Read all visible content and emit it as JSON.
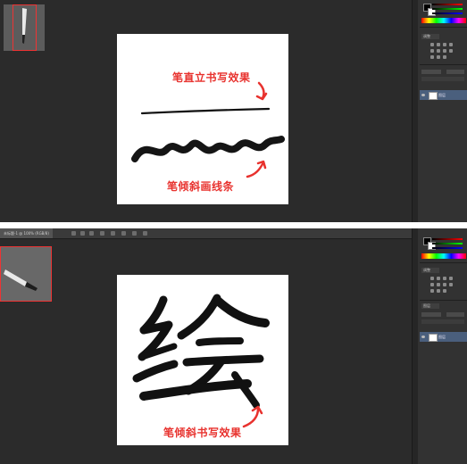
{
  "top": {
    "annotations": {
      "upright": "笔直立书写效果",
      "tilted": "笔倾斜画线条"
    },
    "icons": [
      "brush-icon",
      "arrow-icon"
    ]
  },
  "bottom": {
    "tab_label": "未标题-1 @ 100% (RGB/8)",
    "annotation": "笔倾斜书写效果",
    "glyph": "绘",
    "icons": [
      "brush-icon",
      "arrow-icon"
    ]
  },
  "panel": {
    "adjust_title": "调整",
    "layers_title": "图层",
    "layer_name": "图层"
  },
  "colors": {
    "annotation": "#e8322e",
    "app_bg": "#2b2b2b",
    "panel_bg": "#323232",
    "layer_selected": "#4a5f7d",
    "thumb_border": "#e33333"
  }
}
